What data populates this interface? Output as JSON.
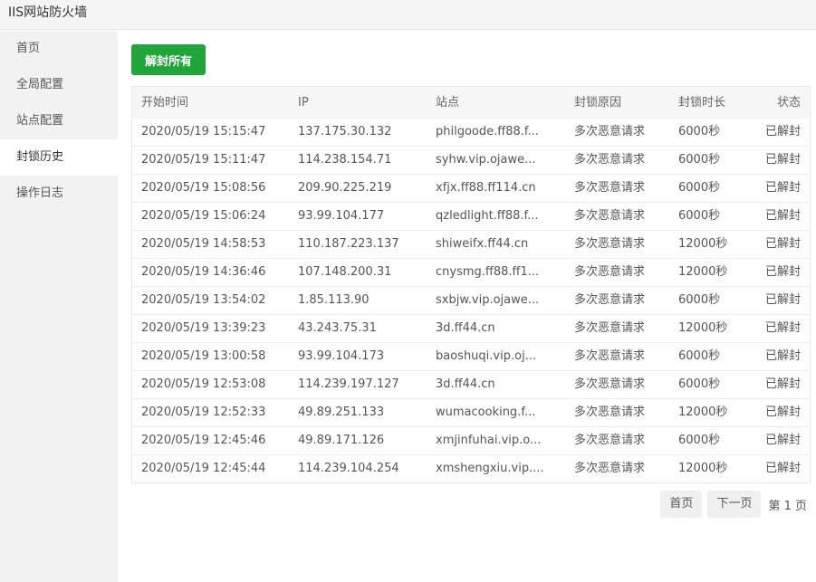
{
  "app": {
    "title": "IIS网站防火墙"
  },
  "sidebar": {
    "items": [
      {
        "label": "首页"
      },
      {
        "label": "全局配置"
      },
      {
        "label": "站点配置"
      },
      {
        "label": "封锁历史",
        "active": true
      },
      {
        "label": "操作日志"
      }
    ]
  },
  "toolbar": {
    "unblock_all_label": "解封所有"
  },
  "table": {
    "columns": [
      "开始时间",
      "IP",
      "站点",
      "封锁原因",
      "封锁时长",
      "状态"
    ],
    "rows": [
      [
        "2020/05/19 15:15:47",
        "137.175.30.132",
        "philgoode.ff88.f...",
        "多次恶意请求",
        "6000秒",
        "已解封"
      ],
      [
        "2020/05/19 15:11:47",
        "114.238.154.71",
        "syhw.vip.ojawe...",
        "多次恶意请求",
        "6000秒",
        "已解封"
      ],
      [
        "2020/05/19 15:08:56",
        "209.90.225.219",
        "xfjx.ff88.ff114.cn",
        "多次恶意请求",
        "6000秒",
        "已解封"
      ],
      [
        "2020/05/19 15:06:24",
        "93.99.104.177",
        "qzledlight.ff88.f...",
        "多次恶意请求",
        "6000秒",
        "已解封"
      ],
      [
        "2020/05/19 14:58:53",
        "110.187.223.137",
        "shiweifx.ff44.cn",
        "多次恶意请求",
        "12000秒",
        "已解封"
      ],
      [
        "2020/05/19 14:36:46",
        "107.148.200.31",
        "cnysmg.ff88.ff1...",
        "多次恶意请求",
        "12000秒",
        "已解封"
      ],
      [
        "2020/05/19 13:54:02",
        "1.85.113.90",
        "sxbjw.vip.ojawe...",
        "多次恶意请求",
        "6000秒",
        "已解封"
      ],
      [
        "2020/05/19 13:39:23",
        "43.243.75.31",
        "3d.ff44.cn",
        "多次恶意请求",
        "12000秒",
        "已解封"
      ],
      [
        "2020/05/19 13:00:58",
        "93.99.104.173",
        "baoshuqi.vip.oj...",
        "多次恶意请求",
        "6000秒",
        "已解封"
      ],
      [
        "2020/05/19 12:53:08",
        "114.239.197.127",
        "3d.ff44.cn",
        "多次恶意请求",
        "6000秒",
        "已解封"
      ],
      [
        "2020/05/19 12:52:33",
        "49.89.251.133",
        "wumacooking.f...",
        "多次恶意请求",
        "12000秒",
        "已解封"
      ],
      [
        "2020/05/19 12:45:46",
        "49.89.171.126",
        "xmjinfuhai.vip.o...",
        "多次恶意请求",
        "6000秒",
        "已解封"
      ],
      [
        "2020/05/19 12:45:44",
        "114.239.104.254",
        "xmshengxiu.vip....",
        "多次恶意请求",
        "12000秒",
        "已解封"
      ]
    ]
  },
  "pager": {
    "first_label": "首页",
    "next_label": "下一页",
    "page_info": "第 1 页"
  },
  "colors": {
    "accent": "#20a53a",
    "sidebar_bg": "#f2f2f2",
    "header_bg": "#f6f6f6"
  }
}
